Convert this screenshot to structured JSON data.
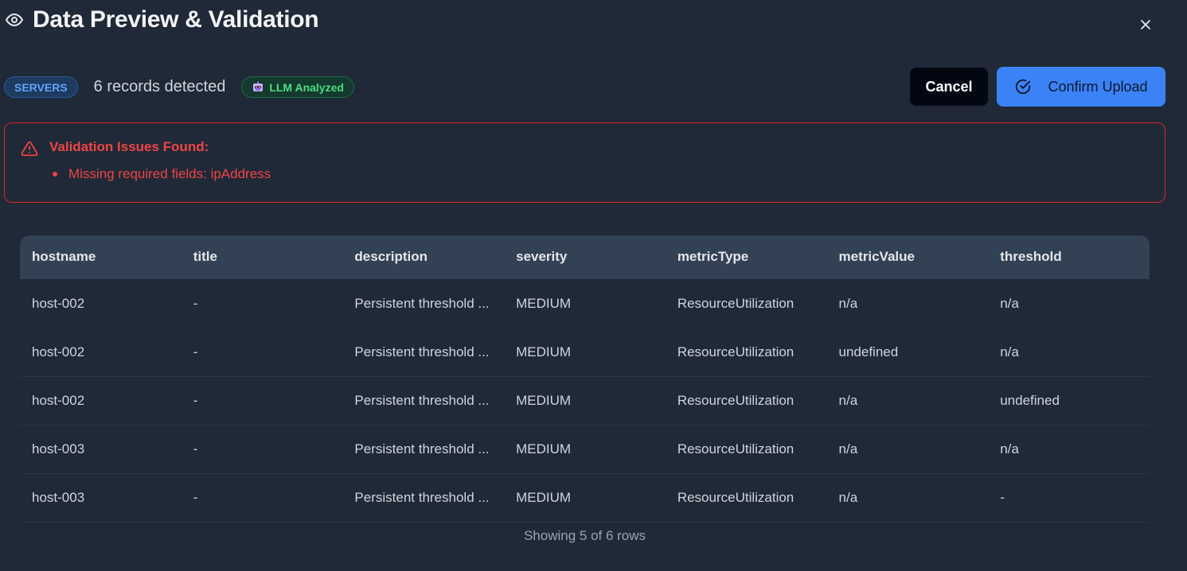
{
  "header": {
    "title": "Data Preview & Validation",
    "icon": "eye-icon"
  },
  "info": {
    "type_badge": "SERVERS",
    "records_text": "6 records detected",
    "llm_badge": "LLM Analyzed"
  },
  "actions": {
    "cancel_label": "Cancel",
    "confirm_label": "Confirm Upload"
  },
  "validation": {
    "title": "Validation Issues Found:",
    "issues": [
      "Missing required fields: ipAddress"
    ]
  },
  "table": {
    "columns": [
      "hostname",
      "title",
      "description",
      "severity",
      "metricType",
      "metricValue",
      "threshold"
    ],
    "rows": [
      [
        "host-002",
        "-",
        "Persistent threshold ...",
        "MEDIUM",
        "ResourceUtilization",
        "n/a",
        "n/a"
      ],
      [
        "host-002",
        "-",
        "Persistent threshold ...",
        "MEDIUM",
        "ResourceUtilization",
        "undefined",
        "n/a"
      ],
      [
        "host-002",
        "-",
        "Persistent threshold ...",
        "MEDIUM",
        "ResourceUtilization",
        "n/a",
        "undefined"
      ],
      [
        "host-003",
        "-",
        "Persistent threshold ...",
        "MEDIUM",
        "ResourceUtilization",
        "n/a",
        "n/a"
      ],
      [
        "host-003",
        "-",
        "Persistent threshold ...",
        "MEDIUM",
        "ResourceUtilization",
        "n/a",
        "-"
      ]
    ],
    "footer": "Showing 5 of 6 rows"
  },
  "colors": {
    "background": "#1f2937",
    "accent": "#3b82f6",
    "error": "#ef4444",
    "success": "#4ade80",
    "table_header": "#334155"
  }
}
